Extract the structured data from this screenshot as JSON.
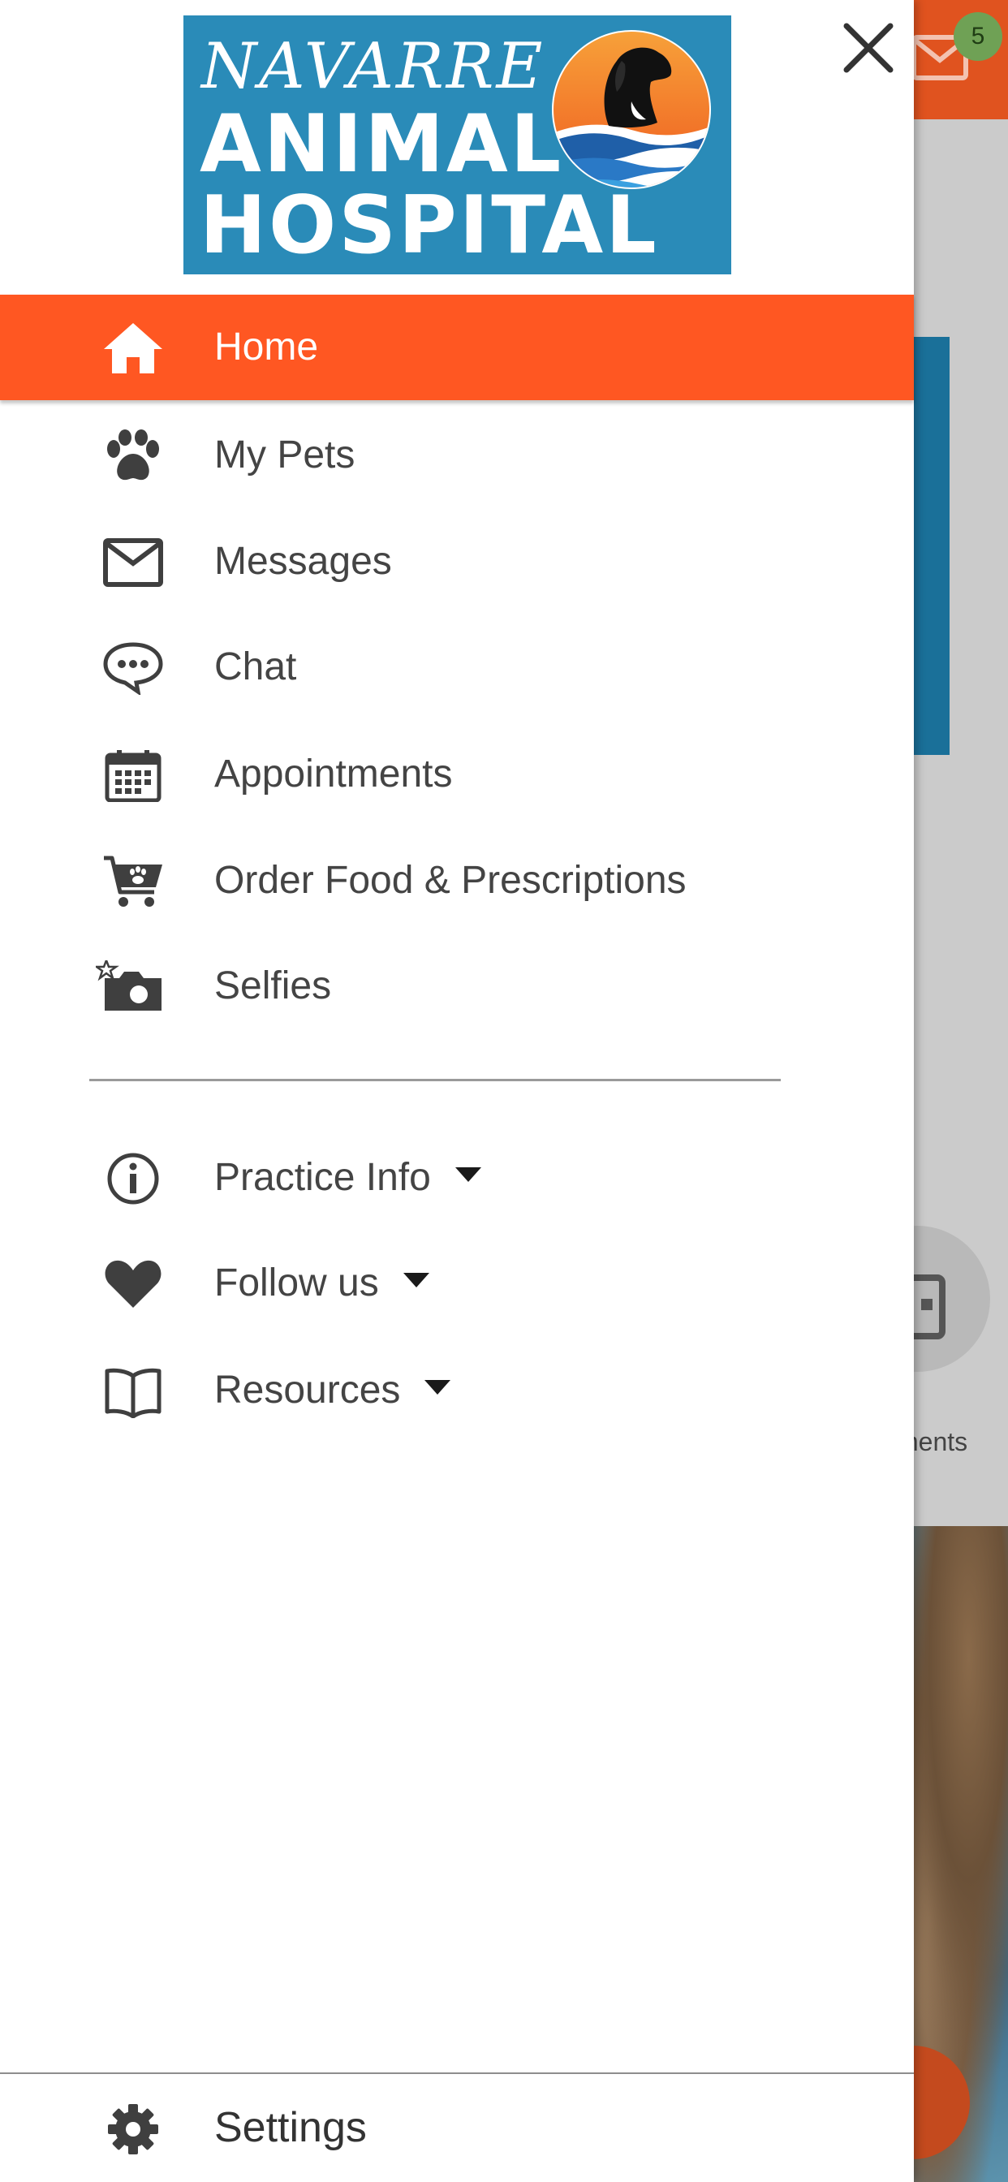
{
  "background": {
    "unread_count": "5",
    "tile_label_partial": "ments"
  },
  "logo": {
    "line1": "NAVARRE",
    "line2": "ANIMAL",
    "line3": "HOSPITAL"
  },
  "menu": {
    "items": [
      {
        "label": "Home",
        "icon": "home-icon",
        "active": true
      },
      {
        "label": "My Pets",
        "icon": "paw-icon"
      },
      {
        "label": "Messages",
        "icon": "envelope-icon"
      },
      {
        "label": "Chat",
        "icon": "chat-bubble-icon"
      },
      {
        "label": "Appointments",
        "icon": "calendar-icon"
      },
      {
        "label": "Order Food & Prescriptions",
        "icon": "cart-icon"
      },
      {
        "label": "Selfies",
        "icon": "camera-icon"
      }
    ],
    "secondary": [
      {
        "label": "Practice Info",
        "icon": "info-icon",
        "expandable": true
      },
      {
        "label": "Follow us",
        "icon": "heart-icon",
        "expandable": true
      },
      {
        "label": "Resources",
        "icon": "book-icon",
        "expandable": true
      }
    ],
    "footer": {
      "label": "Settings",
      "icon": "gear-icon"
    }
  },
  "colors": {
    "accent": "#ff5722",
    "topbar": "#e0531f",
    "logo_bg": "#2a8bb8",
    "badge": "#6fa155",
    "icon": "#3f3f3f"
  }
}
